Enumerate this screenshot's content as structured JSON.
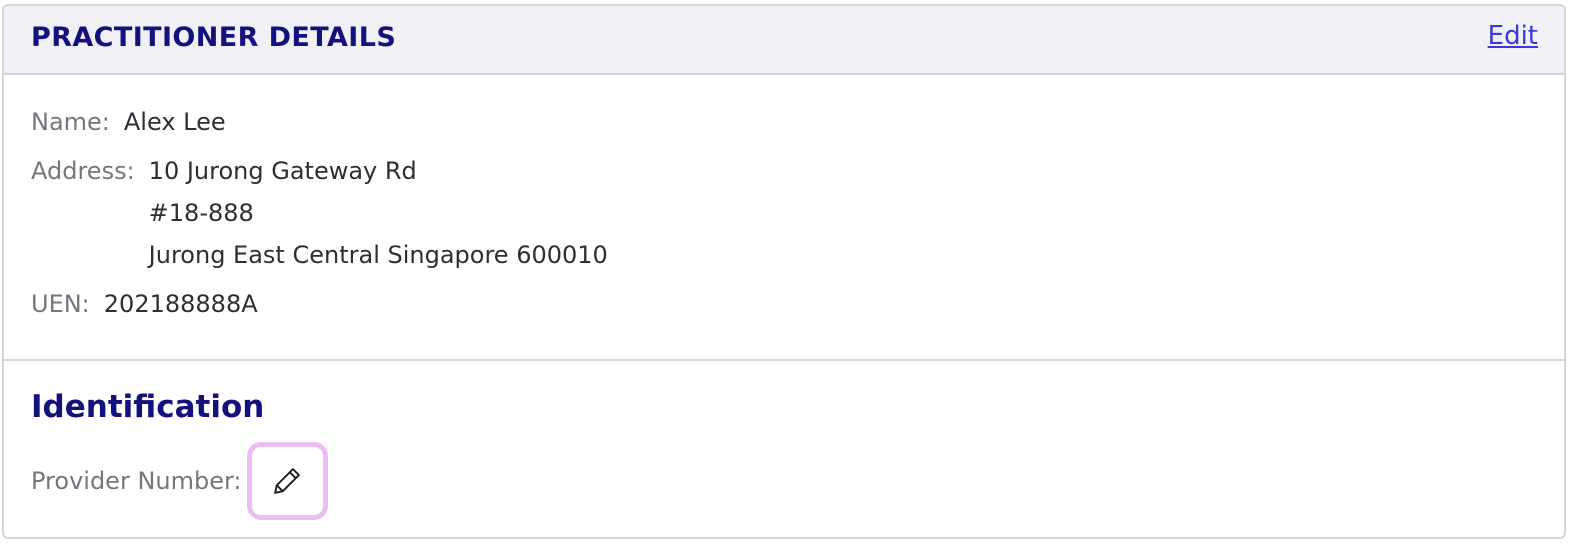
{
  "header": {
    "title": "PRACTITIONER DETAILS",
    "edit_label": "Edit"
  },
  "details": {
    "name_label": "Name:",
    "name_value": "Alex Lee",
    "address_label": "Address:",
    "address_lines": [
      "10 Jurong Gateway Rd",
      "#18-888",
      "Jurong East Central Singapore 600010"
    ],
    "uen_label": "UEN:",
    "uen_value": "202188888A"
  },
  "identification": {
    "title": "Identification",
    "provider_number_label": "Provider Number:",
    "provider_number_value": "",
    "edit_icon": "pencil-icon"
  },
  "colors": {
    "title": "#13117e",
    "link": "#3b37d8",
    "label": "#737780",
    "value": "#2d2f36",
    "header_bg": "#f0f0f5",
    "border": "#d3d5da",
    "focus_ring": "#eebcf5"
  }
}
